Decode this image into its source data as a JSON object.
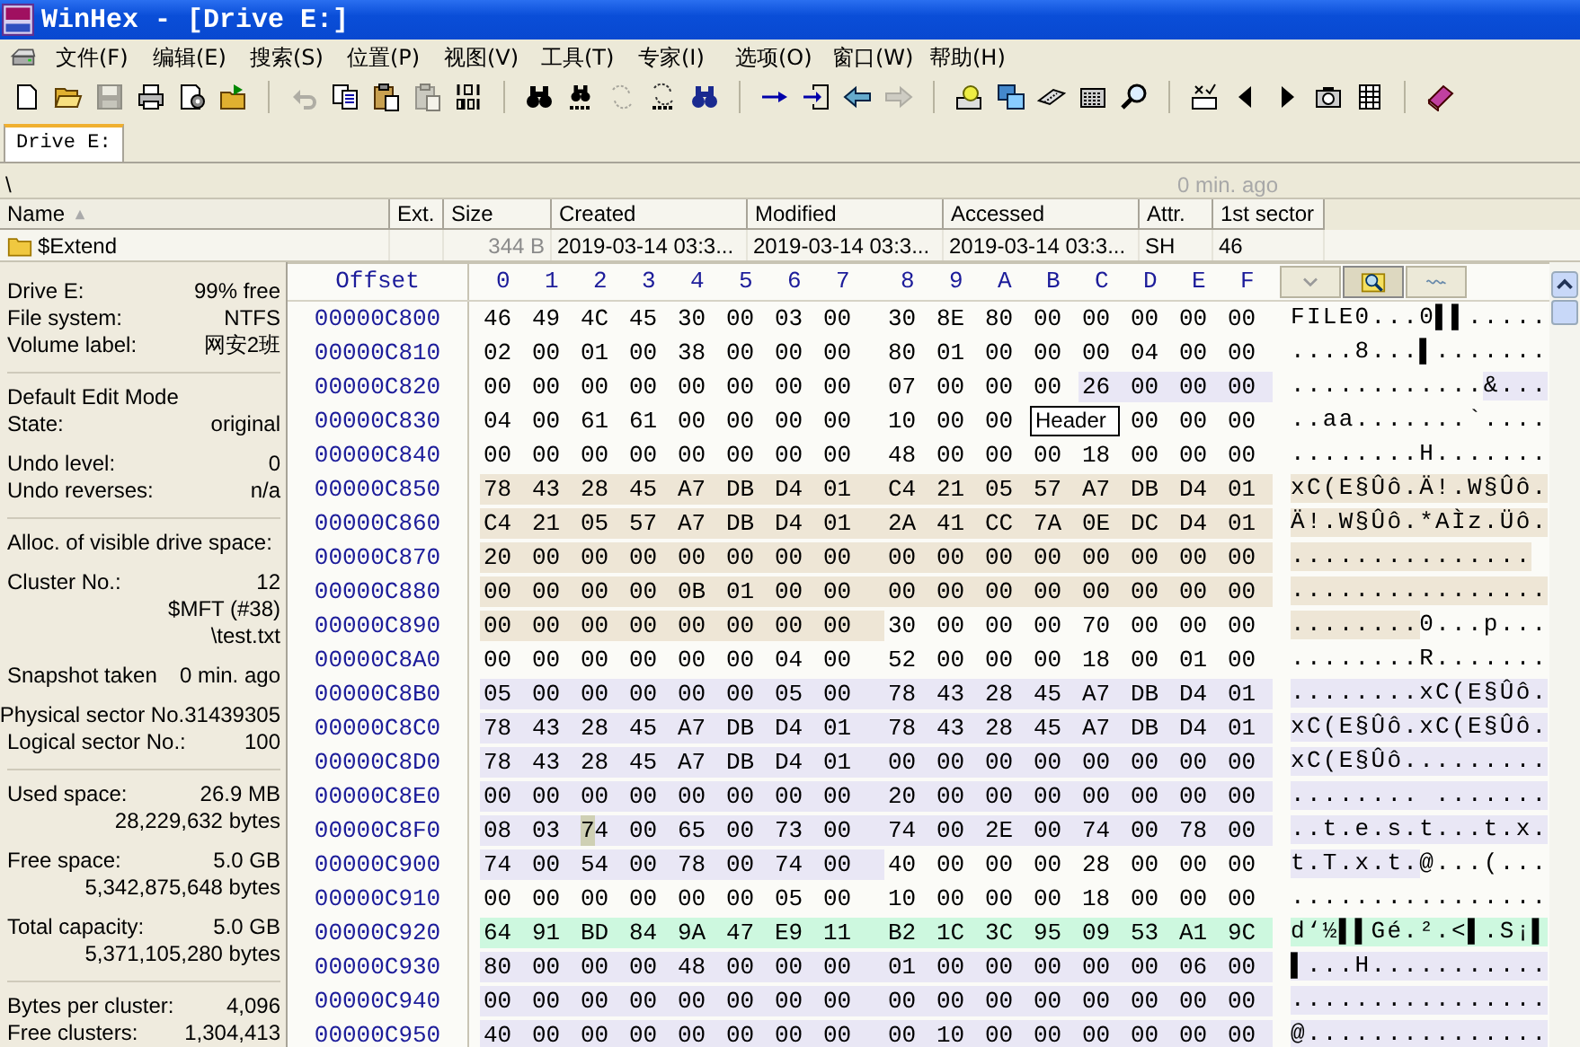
{
  "window": {
    "title": "WinHex - [Drive E:]"
  },
  "menu": [
    "文件(F)",
    "编辑(E)",
    "搜索(S)",
    "位置(P)",
    "视图(V)",
    "工具(T)",
    "专家(I)",
    "选项(O)",
    "窗口(W)",
    "帮助(H)"
  ],
  "toolbar": {
    "groups": [
      [
        {
          "kind": "new",
          "disabled": false
        },
        {
          "kind": "open",
          "disabled": false
        },
        {
          "kind": "save",
          "disabled": true
        },
        {
          "kind": "print",
          "disabled": false
        },
        {
          "kind": "properties",
          "disabled": false
        },
        {
          "kind": "open_folder",
          "disabled": false
        }
      ],
      [
        {
          "kind": "undo",
          "disabled": true
        },
        {
          "kind": "copy",
          "disabled": false
        },
        {
          "kind": "paste",
          "disabled": false
        },
        {
          "kind": "paste",
          "disabled": true
        },
        {
          "kind": "binary",
          "disabled": false
        }
      ],
      [
        {
          "kind": "find",
          "disabled": false
        },
        {
          "kind": "find_hex",
          "disabled": false
        },
        {
          "kind": "replace",
          "disabled": true
        },
        {
          "kind": "replace_hex",
          "disabled": false
        },
        {
          "kind": "find_next",
          "disabled": false
        }
      ],
      [
        {
          "kind": "goto",
          "disabled": false
        },
        {
          "kind": "goto_box",
          "disabled": false
        },
        {
          "kind": "back",
          "disabled": false
        },
        {
          "kind": "forward",
          "disabled": true
        }
      ],
      [
        {
          "kind": "disk",
          "disabled": false
        },
        {
          "kind": "windows",
          "disabled": false
        },
        {
          "kind": "chip",
          "disabled": false
        },
        {
          "kind": "calculator",
          "disabled": false
        },
        {
          "kind": "magnifier",
          "disabled": false
        }
      ],
      [
        {
          "kind": "tools",
          "disabled": false
        },
        {
          "kind": "prev",
          "disabled": false
        },
        {
          "kind": "next",
          "disabled": false
        },
        {
          "kind": "camera",
          "disabled": false
        },
        {
          "kind": "table",
          "disabled": false
        }
      ],
      [
        {
          "kind": "book",
          "disabled": false
        }
      ]
    ]
  },
  "tabs": [
    {
      "label": "Drive E:",
      "selected": true
    }
  ],
  "path_bar": {
    "path": "\\",
    "snapshot": "0 min. ago"
  },
  "file_list": {
    "columns": [
      {
        "label": "Name",
        "sorted": true
      },
      {
        "label": "Ext.",
        "sorted": false
      },
      {
        "label": "Size",
        "sorted": false
      },
      {
        "label": "Created",
        "sorted": false
      },
      {
        "label": "Modified",
        "sorted": false
      },
      {
        "label": "Accessed",
        "sorted": false
      },
      {
        "label": "Attr.",
        "sorted": false
      },
      {
        "label": "1st sector",
        "sorted": false
      }
    ],
    "rows": [
      {
        "kind": "folder",
        "cells": [
          "$Extend",
          "",
          "344 B",
          "2019-03-14  03:3...",
          "2019-03-14  03:3...",
          "2019-03-14  03:3...",
          "SH",
          "46"
        ]
      }
    ]
  },
  "info_panel": {
    "sections": [
      [
        [
          {
            "label": "Drive E:",
            "value": "99% free"
          },
          {
            "label": "File system:",
            "value": "NTFS"
          },
          {
            "label": "Volume label:",
            "value": "网安2班"
          }
        ]
      ],
      [
        [
          {
            "label": "Default Edit Mode"
          },
          {
            "label": "State:",
            "value": "original"
          }
        ],
        [
          {
            "label": "Undo level:",
            "value": "0"
          },
          {
            "label": "Undo reverses:",
            "value": "n/a"
          }
        ]
      ],
      [
        [
          {
            "label": "Alloc. of visible drive space:"
          }
        ],
        [
          {
            "label": "Cluster No.:",
            "value": "12"
          },
          {
            "value": "$MFT (#38)"
          },
          {
            "value": "\\test.txt"
          }
        ],
        [
          {
            "label": "Snapshot taken",
            "value": "0 min. ago"
          }
        ],
        [
          {
            "label": "Physical sector No.",
            "value": "31439305"
          },
          {
            "label": "Logical sector No.:",
            "value": "100"
          }
        ]
      ],
      [
        [
          {
            "label": "Used space:",
            "value": "26.9 MB"
          },
          {
            "value": "28,229,632 bytes"
          }
        ],
        [
          {
            "label": "Free space:",
            "value": "5.0 GB"
          },
          {
            "value": "5,342,875,648 bytes"
          }
        ],
        [
          {
            "label": "Total capacity:",
            "value": "5.0 GB"
          },
          {
            "value": "5,371,105,280 bytes"
          }
        ]
      ],
      [
        [
          {
            "label": "Bytes per cluster:",
            "value": "4,096"
          },
          {
            "label": "Free clusters:",
            "value": "1,304,413"
          }
        ]
      ]
    ]
  },
  "hex_view": {
    "offset_label": "Offset",
    "column_labels": [
      "0",
      "1",
      "2",
      "3",
      "4",
      "5",
      "6",
      "7",
      "8",
      "9",
      "A",
      "B",
      "C",
      "D",
      "E",
      "F"
    ],
    "view_tabs": [
      {
        "kind": "dropdown",
        "selected": false
      },
      {
        "kind": "search",
        "selected": true
      },
      {
        "kind": "wave",
        "selected": false
      }
    ],
    "rows": [
      {
        "offset": "00000C800",
        "segments": [
          {
            "kind": "bytes",
            "cursor": false,
            "bytes": [
              "46",
              "49",
              "4C",
              "45",
              "30",
              "00",
              "03",
              "00",
              "30",
              "8E",
              "80",
              "00",
              "00",
              "00",
              "00",
              "00"
            ],
            "ascii": "FILE0...0▌▌....."
          }
        ]
      },
      {
        "offset": "00000C810",
        "segments": [
          {
            "kind": "bytes",
            "cursor": false,
            "bytes": [
              "02",
              "00",
              "01",
              "00",
              "38",
              "00",
              "00",
              "00",
              "80",
              "01",
              "00",
              "00",
              "00",
              "04",
              "00",
              "00"
            ],
            "ascii": "....8...▌......."
          }
        ]
      },
      {
        "offset": "00000C820",
        "segments": [
          {
            "kind": "bytes",
            "cursor": false,
            "bytes": [
              "00",
              "00",
              "00",
              "00",
              "00",
              "00",
              "00",
              "00",
              "07",
              "00",
              "00",
              "00"
            ],
            "ascii": "............"
          },
          {
            "kind": "bytes",
            "color": "#e9e7f5",
            "cursor": false,
            "bytes": [
              "26",
              "00",
              "00",
              "00"
            ],
            "ascii": "&..."
          }
        ]
      },
      {
        "offset": "00000C830",
        "segments": [
          {
            "kind": "bytes",
            "cursor": false,
            "bytes": [
              "04",
              "00",
              "61",
              "61",
              "00",
              "00",
              "00",
              "00",
              "10",
              "00",
              "00"
            ],
            "ascii": "..aa......."
          },
          {
            "kind": "tooltip",
            "text": "Header",
            "ascii": "`."
          },
          {
            "kind": "bytes",
            "cursor": false,
            "bytes": [
              "00",
              "00",
              "00"
            ],
            "ascii": "..."
          }
        ]
      },
      {
        "offset": "00000C840",
        "segments": [
          {
            "kind": "bytes",
            "cursor": false,
            "bytes": [
              "00",
              "00",
              "00",
              "00",
              "00",
              "00",
              "00",
              "00",
              "48",
              "00",
              "00",
              "00",
              "18",
              "00",
              "00",
              "00"
            ],
            "ascii": "........H......."
          }
        ]
      },
      {
        "offset": "00000C850",
        "segments": [
          {
            "kind": "bytes",
            "color": "#eee6d6",
            "cursor": false,
            "bytes": [
              "78",
              "43",
              "28",
              "45",
              "A7",
              "DB",
              "D4",
              "01",
              "C4",
              "21",
              "05",
              "57",
              "A7",
              "DB",
              "D4",
              "01"
            ],
            "ascii": "xC(E§Ûô.Ä!.W§Ûô."
          }
        ]
      },
      {
        "offset": "00000C860",
        "segments": [
          {
            "kind": "bytes",
            "color": "#eee6d6",
            "cursor": false,
            "bytes": [
              "C4",
              "21",
              "05",
              "57",
              "A7",
              "DB",
              "D4",
              "01",
              "2A",
              "41",
              "CC",
              "7A",
              "0E",
              "DC",
              "D4",
              "01"
            ],
            "ascii": "Ä!.W§Ûô.*AÌz.Üô."
          }
        ]
      },
      {
        "offset": "00000C870",
        "segments": [
          {
            "kind": "bytes",
            "color": "#eee6d6",
            "cursor": false,
            "bytes": [
              "20",
              "00",
              "00",
              "00",
              "00",
              "00",
              "00",
              "00",
              "00",
              "00",
              "00",
              "00",
              "00",
              "00",
              "00",
              "00"
            ],
            "ascii": " ..............."
          }
        ]
      },
      {
        "offset": "00000C880",
        "segments": [
          {
            "kind": "bytes",
            "color": "#eee6d6",
            "cursor": false,
            "bytes": [
              "00",
              "00",
              "00",
              "00",
              "0B",
              "01",
              "00",
              "00",
              "00",
              "00",
              "00",
              "00",
              "00",
              "00",
              "00",
              "00"
            ],
            "ascii": "................"
          }
        ]
      },
      {
        "offset": "00000C890",
        "segments": [
          {
            "kind": "bytes",
            "color": "#eee6d6",
            "cursor": false,
            "bytes": [
              "00",
              "00",
              "00",
              "00",
              "00",
              "00",
              "00",
              "00"
            ],
            "ascii": "........"
          },
          {
            "kind": "bytes",
            "cursor": false,
            "bytes": [
              "30",
              "00",
              "00",
              "00",
              "70",
              "00",
              "00",
              "00"
            ],
            "ascii": "0...p..."
          }
        ]
      },
      {
        "offset": "00000C8A0",
        "segments": [
          {
            "kind": "bytes",
            "cursor": false,
            "bytes": [
              "00",
              "00",
              "00",
              "00",
              "00",
              "00",
              "04",
              "00",
              "52",
              "00",
              "00",
              "00",
              "18",
              "00",
              "01",
              "00"
            ],
            "ascii": "........R......."
          }
        ]
      },
      {
        "offset": "00000C8B0",
        "segments": [
          {
            "kind": "bytes",
            "color": "#e9e7f5",
            "cursor": false,
            "bytes": [
              "05",
              "00",
              "00",
              "00",
              "00",
              "00",
              "05",
              "00",
              "78",
              "43",
              "28",
              "45",
              "A7",
              "DB",
              "D4",
              "01"
            ],
            "ascii": "........xC(E§Ûô."
          }
        ]
      },
      {
        "offset": "00000C8C0",
        "segments": [
          {
            "kind": "bytes",
            "color": "#e9e7f5",
            "cursor": false,
            "bytes": [
              "78",
              "43",
              "28",
              "45",
              "A7",
              "DB",
              "D4",
              "01",
              "78",
              "43",
              "28",
              "45",
              "A7",
              "DB",
              "D4",
              "01"
            ],
            "ascii": "xC(E§Ûô.xC(E§Ûô."
          }
        ]
      },
      {
        "offset": "00000C8D0",
        "segments": [
          {
            "kind": "bytes",
            "color": "#e9e7f5",
            "cursor": false,
            "bytes": [
              "78",
              "43",
              "28",
              "45",
              "A7",
              "DB",
              "D4",
              "01",
              "00",
              "00",
              "00",
              "00",
              "00",
              "00",
              "00",
              "00"
            ],
            "ascii": "xC(E§Ûô........."
          }
        ]
      },
      {
        "offset": "00000C8E0",
        "segments": [
          {
            "kind": "bytes",
            "color": "#e9e7f5",
            "cursor": false,
            "bytes": [
              "00",
              "00",
              "00",
              "00",
              "00",
              "00",
              "00",
              "00",
              "20",
              "00",
              "00",
              "00",
              "00",
              "00",
              "00",
              "00"
            ],
            "ascii": "........ ......."
          }
        ]
      },
      {
        "offset": "00000C8F0",
        "segments": [
          {
            "kind": "bytes",
            "color": "#e9e7f5",
            "cursor": false,
            "bytes": [
              "08",
              "03"
            ],
            "ascii": ".."
          },
          {
            "kind": "bytes",
            "color": "#e9e7f5",
            "cursor": true,
            "bytes": [
              "74"
            ],
            "ascii": "t"
          },
          {
            "kind": "bytes",
            "color": "#e9e7f5",
            "cursor": false,
            "bytes": [
              "00",
              "65",
              "00",
              "73",
              "00",
              "74",
              "00",
              "2E",
              "00",
              "74",
              "00",
              "78",
              "00"
            ],
            "ascii": ".e.s.t...t.x."
          }
        ]
      },
      {
        "offset": "00000C900",
        "segments": [
          {
            "kind": "bytes",
            "color": "#e9e7f5",
            "cursor": false,
            "bytes": [
              "74",
              "00",
              "54",
              "00",
              "78",
              "00",
              "74",
              "00"
            ],
            "ascii": "t.T.x.t."
          },
          {
            "kind": "bytes",
            "cursor": false,
            "bytes": [
              "40",
              "00",
              "00",
              "00",
              "28",
              "00",
              "00",
              "00"
            ],
            "ascii": "@...(..."
          }
        ]
      },
      {
        "offset": "00000C910",
        "segments": [
          {
            "kind": "bytes",
            "cursor": false,
            "bytes": [
              "00",
              "00",
              "00",
              "00",
              "00",
              "00",
              "05",
              "00",
              "10",
              "00",
              "00",
              "00",
              "18",
              "00",
              "00",
              "00"
            ],
            "ascii": "................"
          }
        ]
      },
      {
        "offset": "00000C920",
        "segments": [
          {
            "kind": "bytes",
            "color": "#cdf8df",
            "cursor": false,
            "bytes": [
              "64",
              "91",
              "BD",
              "84",
              "9A",
              "47",
              "E9",
              "11",
              "B2",
              "1C",
              "3C",
              "95",
              "09",
              "53",
              "A1",
              "9C"
            ],
            "ascii": "d‘½▌▌Gé.².<▌.S¡▌"
          }
        ]
      },
      {
        "offset": "00000C930",
        "segments": [
          {
            "kind": "bytes",
            "color": "#e9e7f5",
            "cursor": false,
            "bytes": [
              "80",
              "00",
              "00",
              "00",
              "48",
              "00",
              "00",
              "00",
              "01",
              "00",
              "00",
              "00",
              "00",
              "00",
              "06",
              "00"
            ],
            "ascii": "▌...H..........."
          }
        ]
      },
      {
        "offset": "00000C940",
        "segments": [
          {
            "kind": "bytes",
            "color": "#e9e7f5",
            "cursor": false,
            "bytes": [
              "00",
              "00",
              "00",
              "00",
              "00",
              "00",
              "00",
              "00",
              "00",
              "00",
              "00",
              "00",
              "00",
              "00",
              "00",
              "00"
            ],
            "ascii": "................"
          }
        ]
      },
      {
        "offset": "00000C950",
        "segments": [
          {
            "kind": "bytes",
            "color": "#e9e7f5",
            "cursor": false,
            "bytes": [
              "40",
              "00",
              "00",
              "00",
              "00",
              "00",
              "00",
              "00",
              "00",
              "10",
              "00",
              "00",
              "00",
              "00",
              "00",
              "00"
            ],
            "ascii": "@..............."
          }
        ]
      }
    ]
  }
}
